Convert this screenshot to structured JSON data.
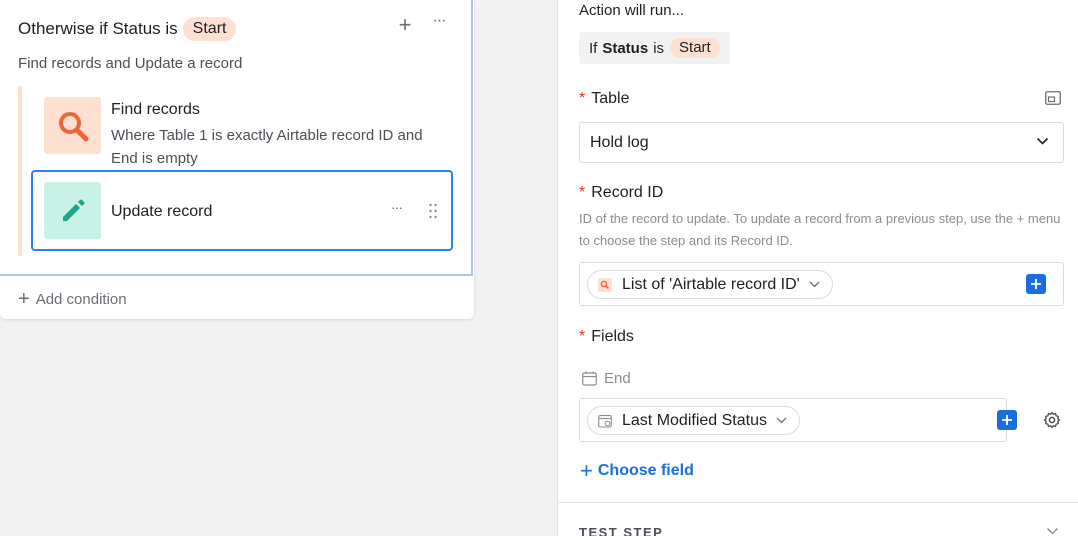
{
  "condition": {
    "title_prefix": "Otherwise if Status is",
    "status_value": "Start",
    "subtitle": "Find records and Update a record",
    "add_condition_label": "Add condition"
  },
  "actions": [
    {
      "title": "Find records",
      "description": "Where Table 1 is exactly Airtable record ID and End is empty",
      "icon": "search-icon",
      "icon_bg": "#fde0cf",
      "icon_color": "#f0643c"
    },
    {
      "title": "Update record",
      "icon": "pencil-icon",
      "icon_bg": "#c8f2e5",
      "icon_color": "#1aa58a",
      "selected": true
    }
  ],
  "panel": {
    "heading": "Action will run...",
    "run_if": {
      "prefix": "If",
      "field": "Status",
      "op": "is",
      "value": "Start"
    },
    "table": {
      "label": "Table",
      "value": "Hold log"
    },
    "record_id": {
      "label": "Record ID",
      "help": "ID of the record to update. To update a record from a previous step, use the + menu to choose the step and its Record ID.",
      "token": "List of 'Airtable record ID'"
    },
    "fields": {
      "label": "Fields",
      "field_name": "End",
      "token": "Last Modified Status"
    },
    "choose_field_label": "Choose field",
    "test_step_label": "TEST STEP"
  },
  "colors": {
    "accent": "#1a6fe0",
    "selected_border": "#2d7ff9",
    "status_pill": "#fde0cf",
    "required": "#e02e2e"
  }
}
